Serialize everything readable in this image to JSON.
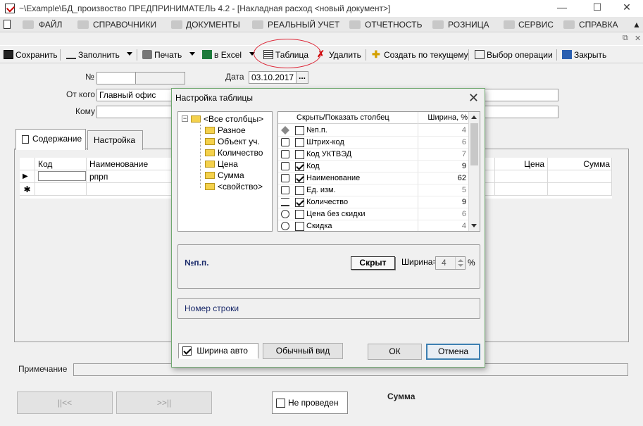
{
  "window": {
    "title": "~\\Example\\БД_произвоство  ПРЕДПРИНИМАТЕЛЬ 4.2 - [Накладная расход <новый документ>]",
    "minimize": "—",
    "maximize": "☐",
    "close": "✕"
  },
  "menu": [
    "ФАЙЛ",
    "СПРАВОЧНИКИ",
    "ДОКУМЕНТЫ",
    "РЕАЛЬНЫЙ УЧЕТ",
    "ОТЧЕТНОСТЬ",
    "РОЗНИЦА",
    "СЕРВИС",
    "СПРАВКА"
  ],
  "mdi_controls": {
    "restore": "⧉",
    "close": "✕"
  },
  "toolbar": {
    "save": "Сохранить",
    "fill": "Заполнить",
    "print": "Печать",
    "excel": "в Excel",
    "table": "Таблица",
    "delete": "Удалить",
    "create_from": "Создать по текущему",
    "choose_op": "Выбор операции",
    "close": "Закрыть"
  },
  "form": {
    "number_label": "№",
    "number_value": "",
    "date_label": "Дата",
    "date_value": "03.10.2017",
    "from_label": "От кого",
    "from_value": "Главный офис",
    "to_label": "Кому",
    "to_value": "",
    "dots": "..."
  },
  "tabs": [
    "Содержание",
    "Настройка"
  ],
  "grid": {
    "columns": [
      "Код",
      "Наименование",
      "Цена",
      "Сумма"
    ],
    "rows": [
      [
        "",
        "рпрп"
      ]
    ],
    "new_row_marker": "✱"
  },
  "bottom": {
    "note_label": "Примечание",
    "nav_first": "||<<",
    "nav_next": ">>||",
    "not_posted": "Не проведен",
    "sum_label": "Сумма"
  },
  "dialog": {
    "title": "Настройка таблицы",
    "close": "✕",
    "tree": {
      "toggle": "−",
      "root": "<Все столбцы>",
      "children": [
        "Разное",
        "Объект уч.",
        "Количество",
        "Цена",
        "Сумма",
        "<свойство>"
      ]
    },
    "columns_header": {
      "name": "Скрыть/Показать столбец",
      "width": "Ширина, %"
    },
    "columns": [
      {
        "name": "№п.п.",
        "width": "4",
        "checked": false,
        "icon": "diamond-icon"
      },
      {
        "name": "Штрих-код",
        "width": "6",
        "checked": false,
        "icon": "gift-icon"
      },
      {
        "name": "Код УКТВЭД",
        "width": "7",
        "checked": false,
        "icon": "gift-icon"
      },
      {
        "name": "Код",
        "width": "9",
        "checked": true,
        "icon": "gift-icon"
      },
      {
        "name": "Наименование",
        "width": "62",
        "checked": true,
        "icon": "gift-icon"
      },
      {
        "name": "Ед. изм.",
        "width": "5",
        "checked": false,
        "icon": "gift-icon"
      },
      {
        "name": "Количество",
        "width": "9",
        "checked": true,
        "icon": "scales-icon"
      },
      {
        "name": "Цена без скидки",
        "width": "6",
        "checked": false,
        "icon": "coin-icon"
      },
      {
        "name": "Скидка",
        "width": "4",
        "checked": false,
        "icon": "coin-icon"
      }
    ],
    "detail": {
      "selected_name": "№п.п.",
      "state_button": "Скрыт",
      "width_label": "Ширина=",
      "width_value": "4",
      "percent": "%"
    },
    "description": "Номер строки",
    "auto_width": "Ширина авто",
    "normal_view": "Обычный вид",
    "ok": "ОК",
    "cancel": "Отмена"
  }
}
